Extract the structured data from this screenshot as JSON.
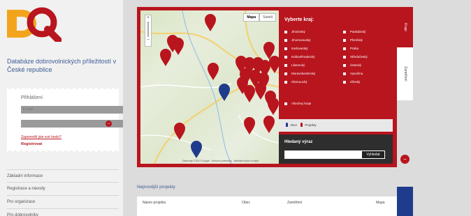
{
  "site": {
    "title": "Databáze dobrovolnických příležitostí v České republice"
  },
  "login": {
    "title": "Přihlášení",
    "email_placeholder": "E-mail",
    "password_placeholder": "",
    "go_icon": "arrow-right-icon",
    "forgot_label": "Zapomněli jste své heslo?",
    "register_label": "Registrovat"
  },
  "nav": {
    "items": [
      {
        "label": "Základní informace"
      },
      {
        "label": "Registrace a návody"
      },
      {
        "label": "Pro organizace"
      },
      {
        "label": "Pro dobrovolníky"
      }
    ]
  },
  "map": {
    "tabs": [
      {
        "label": "Mapa"
      },
      {
        "label": "Satelit"
      }
    ],
    "credit": "Data map ©2012 Google - Smluvní podmínky - Nahlásit chybu v mapě"
  },
  "regions": {
    "title": "Vyberte kraj:",
    "left": [
      {
        "label": "Jihočeský"
      },
      {
        "label": "Jihomoravský"
      },
      {
        "label": "Karlovarský"
      },
      {
        "label": "Královéhradecký"
      },
      {
        "label": "Liberecký"
      },
      {
        "label": "Moravskoslezský"
      },
      {
        "label": "Olomoucký"
      }
    ],
    "right": [
      {
        "label": "Pardubický"
      },
      {
        "label": "Plzeňský"
      },
      {
        "label": "Praha"
      },
      {
        "label": "Středočeský"
      },
      {
        "label": "Ústecký"
      },
      {
        "label": "Vysočina"
      },
      {
        "label": "Zlínský"
      }
    ],
    "all_label": "Všechny kraje"
  },
  "legend": {
    "akce_label": "Akce",
    "projekty_label": "Projekty"
  },
  "search": {
    "title": "Hledaný výraz",
    "button_label": "Vyhledat"
  },
  "side_tabs": {
    "tab1": "Kraje",
    "tab2": "Zaměření"
  },
  "projects": {
    "title": "Nejnovější projekty",
    "columns": [
      {
        "label": "Název projektu"
      },
      {
        "label": "Obec"
      },
      {
        "label": "Zaměření"
      },
      {
        "label": "Mapa"
      }
    ]
  },
  "colors": {
    "brand_red": "#b8151e",
    "brand_orange": "#f2a51c",
    "link_blue": "#3c5a94",
    "pin_blue": "#1f3c8c"
  }
}
